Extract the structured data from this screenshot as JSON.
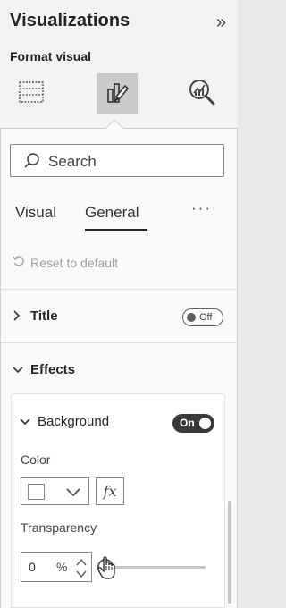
{
  "header": {
    "title": "Visualizations",
    "collapse_glyph": "»",
    "subtitle": "Format visual"
  },
  "mode_icons": [
    {
      "name": "build-visual-icon",
      "active": false
    },
    {
      "name": "format-visual-icon",
      "active": true
    },
    {
      "name": "analytics-icon",
      "active": false
    }
  ],
  "search": {
    "placeholder": "Search"
  },
  "tabs": {
    "visual": "Visual",
    "general": "General",
    "active": "General",
    "more": "···"
  },
  "reset": {
    "label": "Reset to default"
  },
  "sections": {
    "title": {
      "label": "Title",
      "toggle": "Off",
      "expanded": false
    },
    "effects": {
      "label": "Effects",
      "expanded": true,
      "background": {
        "label": "Background",
        "toggle": "On",
        "expanded": true,
        "color_label": "Color",
        "color_value": "#ffffff",
        "fx_label": "fx",
        "transparency_label": "Transparency",
        "transparency_value": "0",
        "transparency_unit": "%"
      }
    }
  }
}
